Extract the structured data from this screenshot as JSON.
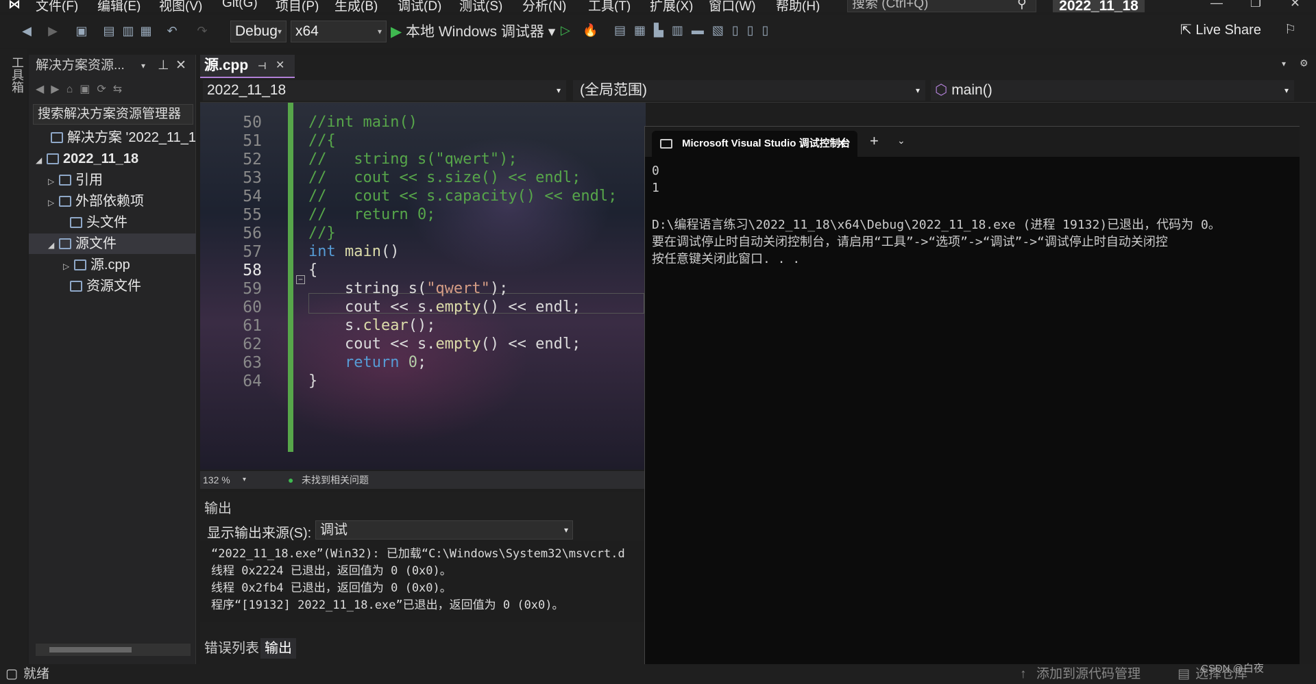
{
  "menu": [
    "文件(F)",
    "编辑(E)",
    "视图(V)",
    "Git(G)",
    "项目(P)",
    "生成(B)",
    "调试(D)",
    "测试(S)",
    "分析(N)",
    "工具(T)",
    "扩展(X)",
    "窗口(W)",
    "帮助(H)"
  ],
  "search_placeholder": "搜索 (Ctrl+Q)",
  "project_title": "2022_11_18",
  "toolbar": {
    "config": "Debug",
    "platform": "x64",
    "run_label": "本地 Windows 调试器",
    "live_share": "Live Share"
  },
  "left_tool_label": "工具箱",
  "solution": {
    "header": "解决方案资源...",
    "search": "搜索解决方案资源管理器",
    "items": [
      {
        "label": "解决方案 '2022_11_18'",
        "indent": 16,
        "exp": ""
      },
      {
        "label": "2022_11_18",
        "indent": 10,
        "exp": "◢",
        "bold": true
      },
      {
        "label": "引用",
        "indent": 28,
        "exp": "▷"
      },
      {
        "label": "外部依赖项",
        "indent": 28,
        "exp": "▷"
      },
      {
        "label": "头文件",
        "indent": 44,
        "exp": ""
      },
      {
        "label": "源文件",
        "indent": 28,
        "exp": "◢"
      },
      {
        "label": "源.cpp",
        "indent": 50,
        "exp": "▷"
      },
      {
        "label": "资源文件",
        "indent": 44,
        "exp": ""
      }
    ]
  },
  "editor": {
    "tab": "源.cpp",
    "nav_project": "2022_11_18",
    "nav_scope": "(全局范围)",
    "nav_member": "main()",
    "lines": [
      {
        "n": "50",
        "t": "//int main()",
        "c": "cm"
      },
      {
        "n": "51",
        "t": "//{",
        "c": "cm"
      },
      {
        "n": "52",
        "t": "//   string s(\"qwert\");",
        "c": "cm"
      },
      {
        "n": "53",
        "t": "//   cout << s.size() << endl;",
        "c": "cm"
      },
      {
        "n": "54",
        "t": "//   cout << s.capacity() << endl;",
        "c": "cm"
      },
      {
        "n": "55",
        "t": "//   return 0;",
        "c": "cm"
      },
      {
        "n": "56",
        "t": "//}",
        "c": "cm"
      },
      {
        "n": "57",
        "t": "int main()",
        "c": "kw"
      },
      {
        "n": "58",
        "t": "{",
        "c": ""
      },
      {
        "n": "59",
        "t": "    string s(\"qwert\");",
        "c": ""
      },
      {
        "n": "60",
        "t": "    cout << s.empty() << endl;",
        "c": ""
      },
      {
        "n": "61",
        "t": "    s.clear();",
        "c": ""
      },
      {
        "n": "62",
        "t": "    cout << s.empty() << endl;",
        "c": ""
      },
      {
        "n": "63",
        "t": "    return 0;",
        "c": "ret"
      },
      {
        "n": "64",
        "t": "}",
        "c": ""
      }
    ],
    "zoom": "132 %",
    "issues": "未找到相关问题"
  },
  "output": {
    "title": "输出",
    "source_label": "显示输出来源(S):",
    "source_value": "调试",
    "lines": [
      "“2022_11_18.exe”(Win32): 已加载“C:\\Windows\\System32\\msvcrt.d",
      "线程 0x2224 已退出，返回值为 0 (0x0)。",
      "线程 0x2fb4 已退出，返回值为 0 (0x0)。",
      "程序“[19132] 2022_11_18.exe”已退出，返回值为 0 (0x0)。"
    ],
    "tabs": [
      "错误列表",
      "输出"
    ]
  },
  "console": {
    "tab_title": "Microsoft Visual Studio 调试控制台",
    "lines": [
      "0",
      "1",
      "",
      "D:\\编程语言练习\\2022_11_18\\x64\\Debug\\2022_11_18.exe (进程 19132)已退出，代码为 0。",
      "要在调试停止时自动关闭控制台，请启用“工具”->“选项”->“调试”->“调试停止时自动关闭控",
      "按任意键关闭此窗口. . ."
    ]
  },
  "status": {
    "ready": "就绪",
    "source_control": "添加到源代码管理",
    "repo": "选择仓库",
    "watermark": "CSDN @白夜"
  }
}
